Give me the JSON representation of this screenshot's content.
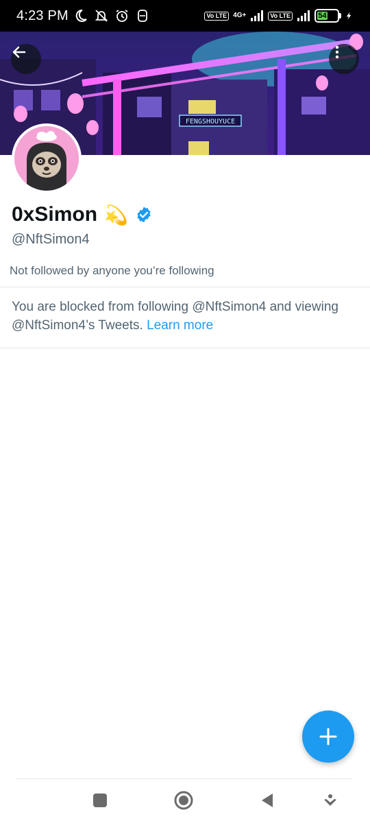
{
  "status_bar": {
    "time": "4:23 PM",
    "network_1": "Vo LTE",
    "network_gen": "4G+",
    "network_2": "Vo LTE",
    "battery_level": "54",
    "battery_fraction": 0.54,
    "icons": [
      "moon-icon",
      "mute-icon",
      "alarm-icon",
      "app-notification-icon",
      "volte-icon",
      "signal-icon",
      "signal-icon",
      "battery-icon",
      "charging-icon"
    ]
  },
  "header": {
    "back_icon": "arrow-left-icon",
    "more_icon": "more-vertical-icon",
    "banner_sign_1": "FENGSHOUYUCE"
  },
  "profile": {
    "display_name": "0xSimon",
    "name_emoji": "💫",
    "verified_icon": "verified-badge-icon",
    "handle": "@NftSimon4",
    "followers_note": "Not followed by anyone you’re following"
  },
  "blocked_notice": {
    "text": "You are blocked from following @NftSimon4 and viewing @NftSimon4’s Tweets. ",
    "link": "Learn more"
  },
  "fab": {
    "icon": "plus-icon"
  },
  "nav": {
    "icons": [
      "recents-square-icon",
      "home-circle-icon",
      "back-triangle-icon",
      "assistant-icon"
    ]
  },
  "colors": {
    "accent": "#1d9bf0",
    "secondary_text": "#536471",
    "avatar_bg": "#f4a3d4"
  }
}
